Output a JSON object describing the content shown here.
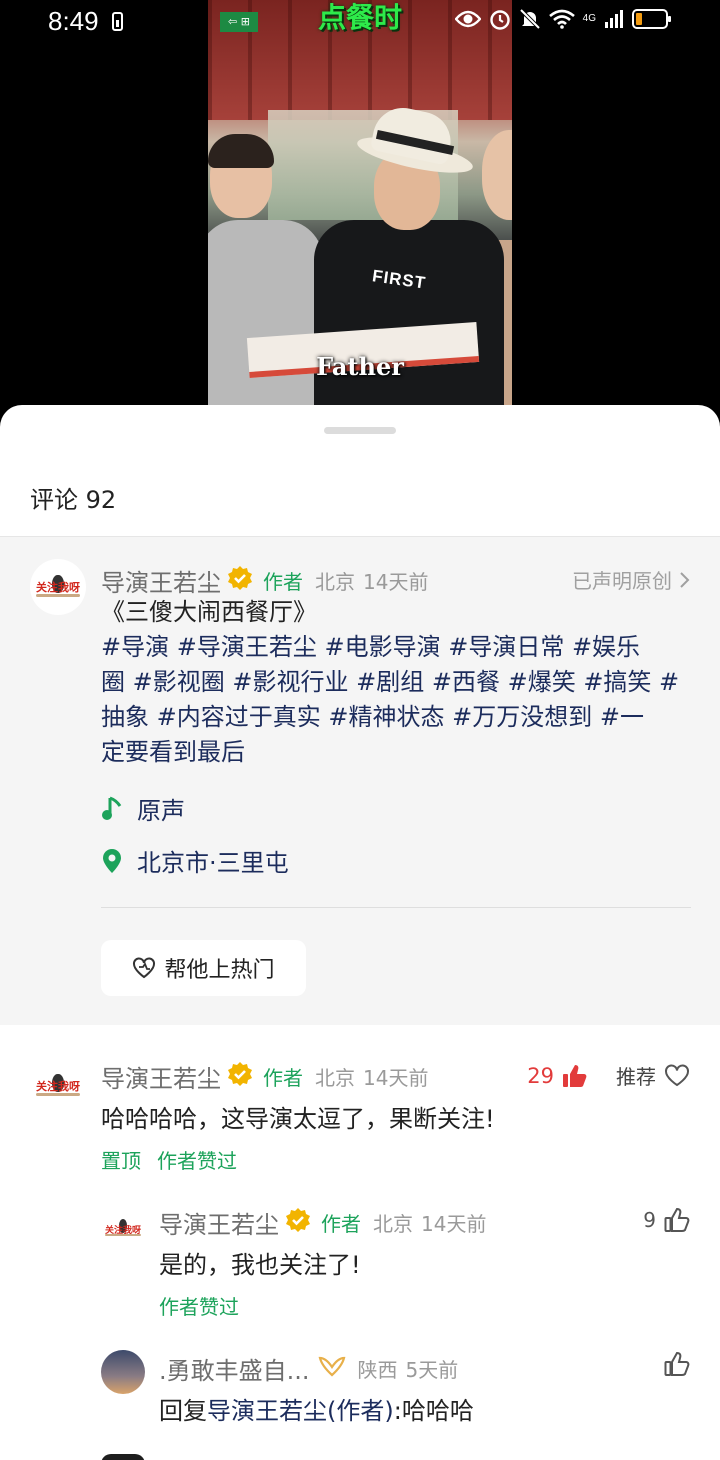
{
  "status_bar": {
    "time": "8:49",
    "network": "4G",
    "icons": [
      "eye-icon",
      "alarm-icon",
      "mute-icon",
      "wifi-icon",
      "signal-icon",
      "battery-icon"
    ]
  },
  "video": {
    "title_overlay": "点餐时",
    "subtitle": "Father",
    "shirt_logo": "FIRST"
  },
  "comments_panel": {
    "header": "评论 92",
    "post": {
      "author": "导演王若尘",
      "author_tag": "作者",
      "location": "北京",
      "time": "14天前",
      "original_label": "已声明原创",
      "title": "《三傻大闹西餐厅》",
      "text_lines": [
        "#导演 #导演王若尘 #电影导演 #导演日常 #娱乐",
        "圈 #影视圈 #影视行业 #剧组 #西餐 #爆笑 #搞笑 #",
        "抽象 #内容过于真实 #精神状态 #万万没想到 #一",
        "定要看到最后"
      ],
      "music": "原声",
      "place": "北京市·三里屯",
      "hot_button": "帮他上热门"
    },
    "comments": [
      {
        "author": "导演王若尘",
        "tag": "作者",
        "location": "北京",
        "time": "14天前",
        "likes": "29",
        "recommend_label": "推荐",
        "text": "哈哈哈哈，这导演太逗了，果断关注!",
        "actions": [
          "置顶",
          "作者赞过"
        ]
      },
      {
        "author": "导演王若尘",
        "tag": "作者",
        "location": "北京",
        "time": "14天前",
        "likes": "9",
        "text": "是的，我也关注了!",
        "actions": [
          "作者赞过"
        ]
      },
      {
        "author": ".勇敢丰盛自...",
        "location": "陕西",
        "time": "5天前",
        "reply_prefix": "回复",
        "reply_target": "导演王若尘(作者)",
        "reply_text": ":哈哈哈"
      }
    ],
    "avatar_text": "关注我呀"
  },
  "colors": {
    "accent_green": "#1da35b",
    "hashtag_blue": "#1c2c5c",
    "like_red": "#e23b3b",
    "verified_gold": "#f2b400",
    "card_bg": "#f5f5f5"
  }
}
